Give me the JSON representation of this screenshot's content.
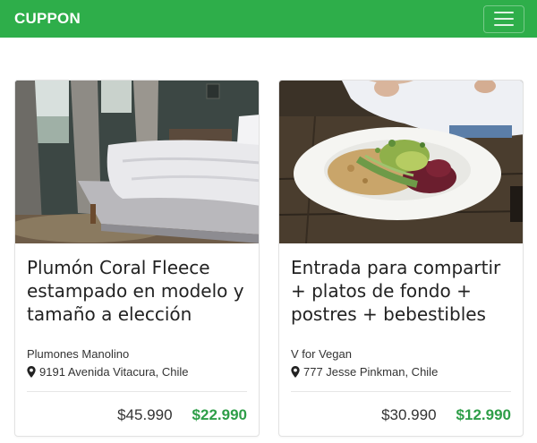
{
  "header": {
    "brand": "CUPPON",
    "menu_icon": "hamburger-menu-icon"
  },
  "colors": {
    "brand_green": "#2eae4a",
    "price_green": "#2e9e48"
  },
  "cards": [
    {
      "title": "Plumón Coral Fleece estampado en modelo y tamaño a elección",
      "vendor": "Plumones Manolino",
      "address": "9191 Avenida Vitacura, Chile",
      "old_price": "$45.990",
      "new_price": "$22.990",
      "image": "bedroom-bed-photo"
    },
    {
      "title": "Entrada para compartir + platos de fondo + postres + bebestibles",
      "vendor": "V for Vegan",
      "address": "777 Jesse Pinkman, Chile",
      "old_price": "$30.990",
      "new_price": "$12.990",
      "image": "vegan-salad-plate-photo"
    }
  ]
}
